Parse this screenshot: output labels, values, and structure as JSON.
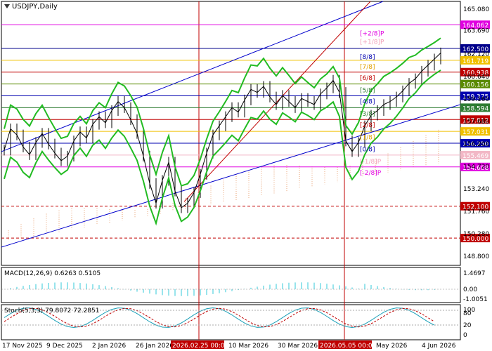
{
  "window": {
    "symbol": "USDJPY",
    "timeframe": "Daily"
  },
  "chart_data": {
    "type": "line",
    "xlabels": [
      "17 Nov 2025",
      "9 Dec 2025",
      "2 Jan 2026",
      "26 Jan 2026",
      "2026.02.25 00:00",
      "10 Mar 2026",
      "30 Mar 2026",
      "2026.05.05 00:00",
      "May 2026",
      "4 Jun 2026"
    ],
    "ylim": [
      148.2,
      165.6
    ],
    "price_scale_labels": [
      "165.080",
      "163.690",
      "162.120",
      "160.640",
      "159.160",
      "157.680",
      "156.200",
      "154.720",
      "153.240",
      "151.760",
      "150.280",
      "148.800"
    ],
    "horizontal_levels": [
      {
        "value": 164.062,
        "label": "164.062",
        "color": "#e000e0",
        "style": "solid"
      },
      {
        "value": 162.5,
        "label": "162.500",
        "color": "#00008b",
        "style": "solid"
      },
      {
        "value": 161.719,
        "label": "161.719",
        "color": "#f0c000",
        "style": "solid"
      },
      {
        "value": 160.938,
        "label": "160.938",
        "color": "#c00000",
        "style": "solid"
      },
      {
        "value": 160.156,
        "label": "160.156",
        "color": "#5a8a00",
        "style": "solid"
      },
      {
        "value": 159.375,
        "label": "159.375",
        "color": "#0000b0",
        "style": "solid"
      },
      {
        "value": 158.594,
        "label": "158.594",
        "color": "#2e7d32",
        "style": "solid"
      },
      {
        "value": 157.812,
        "label": "157.812",
        "color": "#c00000",
        "style": "solid"
      },
      {
        "value": 157.031,
        "label": "157.031",
        "color": "#f0c000",
        "style": "solid"
      },
      {
        "value": 156.25,
        "label": "156.250",
        "color": "#0000b0",
        "style": "solid"
      },
      {
        "value": 155.469,
        "label": "155.469",
        "color": "#f2b8c6",
        "style": "solid"
      },
      {
        "value": 154.688,
        "label": "154.688",
        "color": "#e000e0",
        "style": "solid"
      },
      {
        "value": 152.1,
        "label": "152.100",
        "color": "#c00000",
        "style": "dashed"
      },
      {
        "value": 150.0,
        "label": "150.000",
        "color": "#c00000",
        "style": "dashed"
      }
    ],
    "murrey_labels": [
      {
        "text": "[+2/8]P",
        "value": 163.5,
        "color": "#e000e0"
      },
      {
        "text": "[+1/8]P",
        "value": 162.95,
        "color": "#f2a0b8"
      },
      {
        "text": "[8/8]",
        "value": 161.95,
        "color": "#0000b0"
      },
      {
        "text": "[7/8]",
        "value": 161.3,
        "color": "#e0a000"
      },
      {
        "text": "[6/8]",
        "value": 160.55,
        "color": "#c00000"
      },
      {
        "text": "[5/8]",
        "value": 159.75,
        "color": "#2e7d32"
      },
      {
        "text": "[4/8]",
        "value": 159.0,
        "color": "#0000b0"
      },
      {
        "text": "[3/8]",
        "value": 158.2,
        "color": "#2e7d32"
      },
      {
        "text": "[2/8]",
        "value": 157.45,
        "color": "#c00000"
      },
      {
        "text": "[1/8]",
        "value": 156.65,
        "color": "#e0a000"
      },
      {
        "text": "[0/8]",
        "value": 155.85,
        "color": "#0000b0"
      },
      {
        "text": "[-1/8]P",
        "value": 155.05,
        "color": "#f2a0b8"
      },
      {
        "text": "[-2/8]P",
        "value": 154.3,
        "color": "#e000e0"
      }
    ],
    "price_series": [
      [
        0,
        155.8
      ],
      [
        3,
        157.2
      ],
      [
        6,
        156.8
      ],
      [
        9,
        156.0
      ],
      [
        12,
        155.5
      ],
      [
        15,
        156.3
      ],
      [
        18,
        156.9
      ],
      [
        21,
        156.2
      ],
      [
        24,
        155.6
      ],
      [
        27,
        155.1
      ],
      [
        30,
        155.4
      ],
      [
        33,
        156.4
      ],
      [
        36,
        157.0
      ],
      [
        39,
        156.6
      ],
      [
        42,
        157.5
      ],
      [
        45,
        158.0
      ],
      [
        48,
        157.6
      ],
      [
        51,
        158.4
      ],
      [
        54,
        159.0
      ],
      [
        57,
        158.6
      ],
      [
        60,
        157.8
      ],
      [
        63,
        156.9
      ],
      [
        66,
        155.4
      ],
      [
        69,
        153.6
      ],
      [
        72,
        152.3
      ],
      [
        75,
        153.8
      ],
      [
        78,
        155.0
      ],
      [
        81,
        153.1
      ],
      [
        84,
        152.0
      ],
      [
        87,
        152.3
      ],
      [
        90,
        153.0
      ],
      [
        93,
        154.2
      ],
      [
        96,
        155.6
      ],
      [
        99,
        156.8
      ],
      [
        102,
        157.4
      ],
      [
        105,
        158.0
      ],
      [
        108,
        158.6
      ],
      [
        111,
        158.3
      ],
      [
        114,
        159.1
      ],
      [
        117,
        159.8
      ],
      [
        120,
        159.6
      ],
      [
        123,
        160.0
      ],
      [
        126,
        159.3
      ],
      [
        129,
        158.8
      ],
      [
        132,
        159.4
      ],
      [
        135,
        159.0
      ],
      [
        138,
        158.6
      ],
      [
        141,
        159.2
      ],
      [
        144,
        159.0
      ],
      [
        147,
        158.8
      ],
      [
        150,
        159.5
      ],
      [
        153,
        159.9
      ],
      [
        156,
        160.4
      ],
      [
        159,
        159.6
      ],
      [
        162,
        156.4
      ],
      [
        165,
        155.7
      ],
      [
        168,
        156.3
      ],
      [
        171,
        157.4
      ],
      [
        174,
        158.1
      ],
      [
        177,
        158.4
      ],
      [
        180,
        158.8
      ],
      [
        183,
        159.0
      ],
      [
        186,
        159.3
      ],
      [
        189,
        159.7
      ],
      [
        192,
        160.2
      ],
      [
        195,
        160.5
      ],
      [
        198,
        161.0
      ],
      [
        201,
        161.4
      ],
      [
        204,
        161.8
      ],
      [
        207,
        162.2
      ]
    ],
    "current_price": 161.719,
    "indicators": {
      "macd": {
        "label": "MACD(12,26,9) 0.6263 0.5105",
        "scale": [
          "1.4697",
          "0.00",
          "-1.0051"
        ]
      },
      "stoch": {
        "label": "Stoch(5,3,3) 79.8072 72.2851",
        "scale": [
          "100",
          "80",
          "20",
          "0"
        ]
      }
    }
  }
}
